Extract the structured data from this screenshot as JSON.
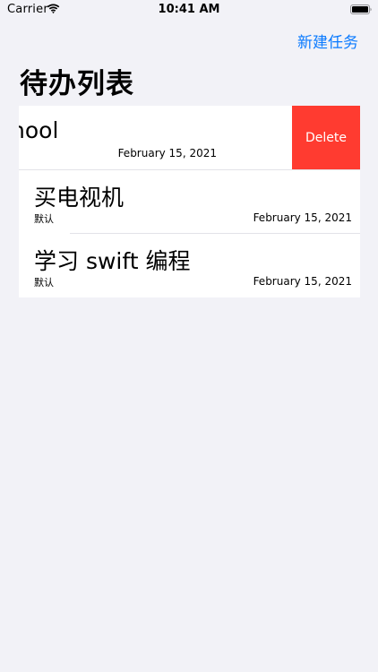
{
  "status_bar": {
    "carrier": "Carrier",
    "time": "10:41 AM"
  },
  "nav": {
    "new_task_label": "新建任务"
  },
  "page": {
    "title": "待办列表"
  },
  "tasks": [
    {
      "title": "o school",
      "category": "",
      "date": "February 15, 2021",
      "swiped": true,
      "delete_label": "Delete"
    },
    {
      "title": "买电视机",
      "category": "默认",
      "date": "February 15, 2021"
    },
    {
      "title": "学习 swift 编程",
      "category": "默认",
      "date": "February 15, 2021"
    }
  ],
  "colors": {
    "accent": "#0A7AFF",
    "destructive": "#FF3B30",
    "background": "#F2F2F7"
  }
}
